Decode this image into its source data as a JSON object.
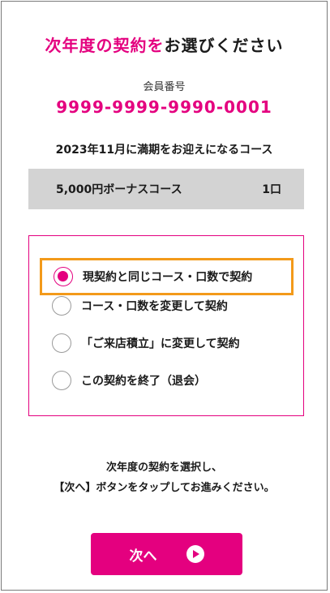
{
  "header": {
    "title_accent": "次年度の契約を",
    "title_rest": "お選びください"
  },
  "member": {
    "label": "会員番号",
    "number": "9999-9999-9990-0001"
  },
  "maturity_text": "2023年11月に満期をお迎えになるコース",
  "course": {
    "name": "5,000円ボーナスコース",
    "units": "1口"
  },
  "options": [
    {
      "label": "現契約と同じコース・口数で契約",
      "selected": true
    },
    {
      "label": "コース・口数を変更して契約",
      "selected": false
    },
    {
      "label": "「ご来店積立」に変更して契約",
      "selected": false
    },
    {
      "label": "この契約を終了（退会）",
      "selected": false
    }
  ],
  "instruction": {
    "line1": "次年度の契約を選択し、",
    "line2": "【次へ】ボタンをタップしてお進みください。"
  },
  "next_button": {
    "label": "次へ",
    "icon": "play-circle-icon"
  },
  "colors": {
    "accent": "#e4007f",
    "highlight": "#f39a1a",
    "course_bg": "#d3d3d3"
  }
}
